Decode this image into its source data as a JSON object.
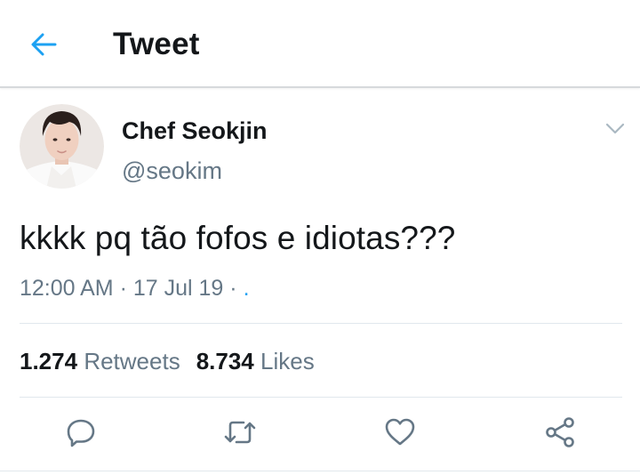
{
  "header": {
    "back_icon": "arrow-left-icon",
    "title": "Tweet"
  },
  "tweet": {
    "author": {
      "display_name": "Chef Seokjin",
      "handle": "@seokim"
    },
    "text": "kkkk pq tão fofos e idiotas???",
    "time": "12:00 AM",
    "date": "17 Jul 19",
    "separator": "·",
    "source": "."
  },
  "stats": {
    "retweets_count": "1.274",
    "retweets_label": "Retweets",
    "likes_count": "8.734",
    "likes_label": "Likes"
  },
  "actions": [
    {
      "icon": "reply-icon"
    },
    {
      "icon": "retweet-icon"
    },
    {
      "icon": "like-icon"
    },
    {
      "icon": "share-icon"
    }
  ],
  "colors": {
    "accent": "#1da1f2",
    "text_primary": "#14171a",
    "text_secondary": "#657786",
    "divider": "#e1e8ed"
  }
}
